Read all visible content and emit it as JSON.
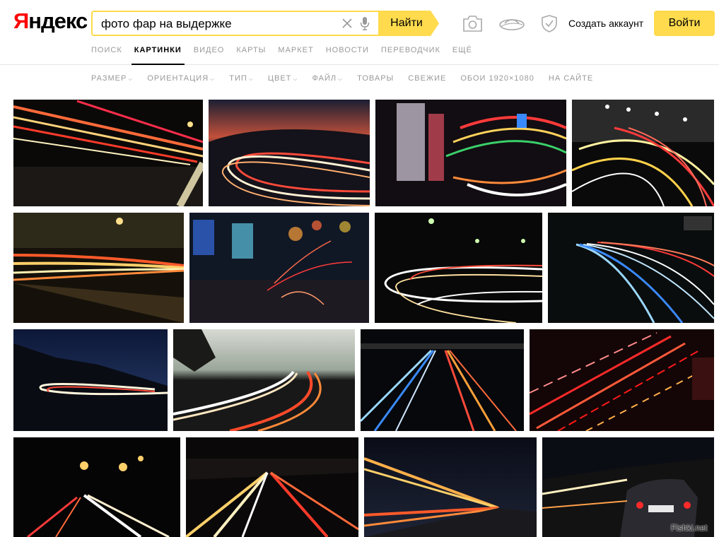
{
  "brand": {
    "logo_first": "Я",
    "logo_rest": "ндекс"
  },
  "search": {
    "query": "фото фар на выдержке",
    "button_label": "Найти"
  },
  "header": {
    "create_account": "Создать аккаунт",
    "login": "Войти"
  },
  "nav": [
    "ПОИСК",
    "КАРТИНКИ",
    "ВИДЕО",
    "КАРТЫ",
    "МАРКЕТ",
    "НОВОСТИ",
    "ПЕРЕВОДЧИК",
    "ЕЩЁ"
  ],
  "nav_active": "КАРТИНКИ",
  "filters": [
    {
      "label": "РАЗМЕР",
      "dropdown": true
    },
    {
      "label": "ОРИЕНТАЦИЯ",
      "dropdown": true
    },
    {
      "label": "ТИП",
      "dropdown": true
    },
    {
      "label": "ЦВЕТ",
      "dropdown": true
    },
    {
      "label": "ФАЙЛ",
      "dropdown": true
    },
    {
      "label": "ТОВАРЫ",
      "dropdown": false
    },
    {
      "label": "СВЕЖИЕ",
      "dropdown": false
    },
    {
      "label": "ОБОИ 1920×1080",
      "dropdown": false
    },
    {
      "label": "НА САЙТЕ",
      "dropdown": false
    }
  ],
  "colors": {
    "accent": "#ffdb4d",
    "logo_red": "#ff0000",
    "muted": "#999999"
  },
  "watermark": "Fishki.net"
}
